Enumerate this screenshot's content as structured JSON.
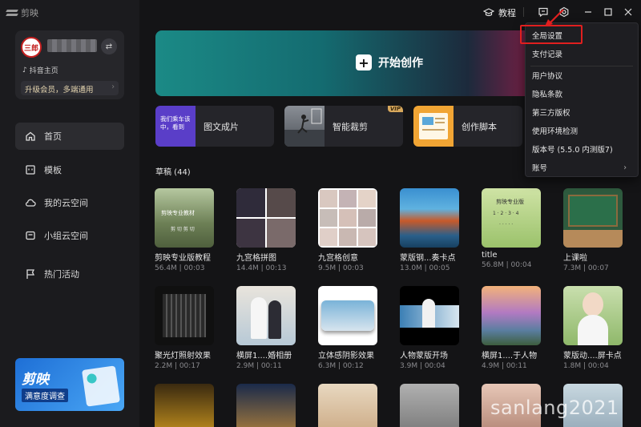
{
  "app": {
    "title": "剪映"
  },
  "titlebar": {
    "tutorial_label": "教程"
  },
  "sidebar": {
    "profile": {
      "avatar_text": "三郎",
      "douyin_label": "抖音主页",
      "vip_label": "升级会员，多端通用"
    },
    "nav": [
      {
        "label": "首页",
        "icon": "home-icon"
      },
      {
        "label": "模板",
        "icon": "template-icon"
      },
      {
        "label": "我的云空间",
        "icon": "cloud-icon"
      },
      {
        "label": "小组云空间",
        "icon": "group-cloud-icon"
      },
      {
        "label": "热门活动",
        "icon": "flag-icon"
      }
    ],
    "banner": {
      "title": "剪映",
      "subtitle": "满意度调查"
    }
  },
  "hero": {
    "label": "开始创作"
  },
  "features": [
    {
      "label": "图文成片",
      "thumb_text": "我们乘车该中，看到"
    },
    {
      "label": "智能裁剪",
      "badge": "VIP"
    },
    {
      "label": "创作脚本"
    }
  ],
  "drafts": {
    "title": "草稿 (44)",
    "items": [
      {
        "name": "剪映专业版教程",
        "meta": "56.4M | 00:03"
      },
      {
        "name": "九宫格拼图",
        "meta": "14.4M | 00:13"
      },
      {
        "name": "九宫格创意",
        "meta": "9.5M | 00:03"
      },
      {
        "name": "蒙版钢...奏卡点",
        "meta": "13.0M | 00:05"
      },
      {
        "name": "title",
        "meta": "56.8M | 00:04"
      },
      {
        "name": "上课啦",
        "meta": "7.3M | 00:07"
      },
      {
        "name": "聚光灯照射效果",
        "meta": "2.2M | 00:17"
      },
      {
        "name": "横屏1....婚相册",
        "meta": "2.9M | 00:11"
      },
      {
        "name": "立体感阴影效果",
        "meta": "6.3M | 00:12"
      },
      {
        "name": "人物蒙版开场",
        "meta": "3.9M | 00:04"
      },
      {
        "name": "横屏1....于人物",
        "meta": "4.9M | 00:11"
      },
      {
        "name": "蒙版动....屏卡点",
        "meta": "1.8M | 00:04"
      }
    ]
  },
  "menu": {
    "items": [
      "全局设置",
      "支付记录",
      "用户协议",
      "隐私条款",
      "第三方版权",
      "使用环境检测",
      "版本号 (5.5.0 内测版7)",
      "账号"
    ],
    "highlight_color": "#e01f1f"
  },
  "watermark": "sanlang2021"
}
